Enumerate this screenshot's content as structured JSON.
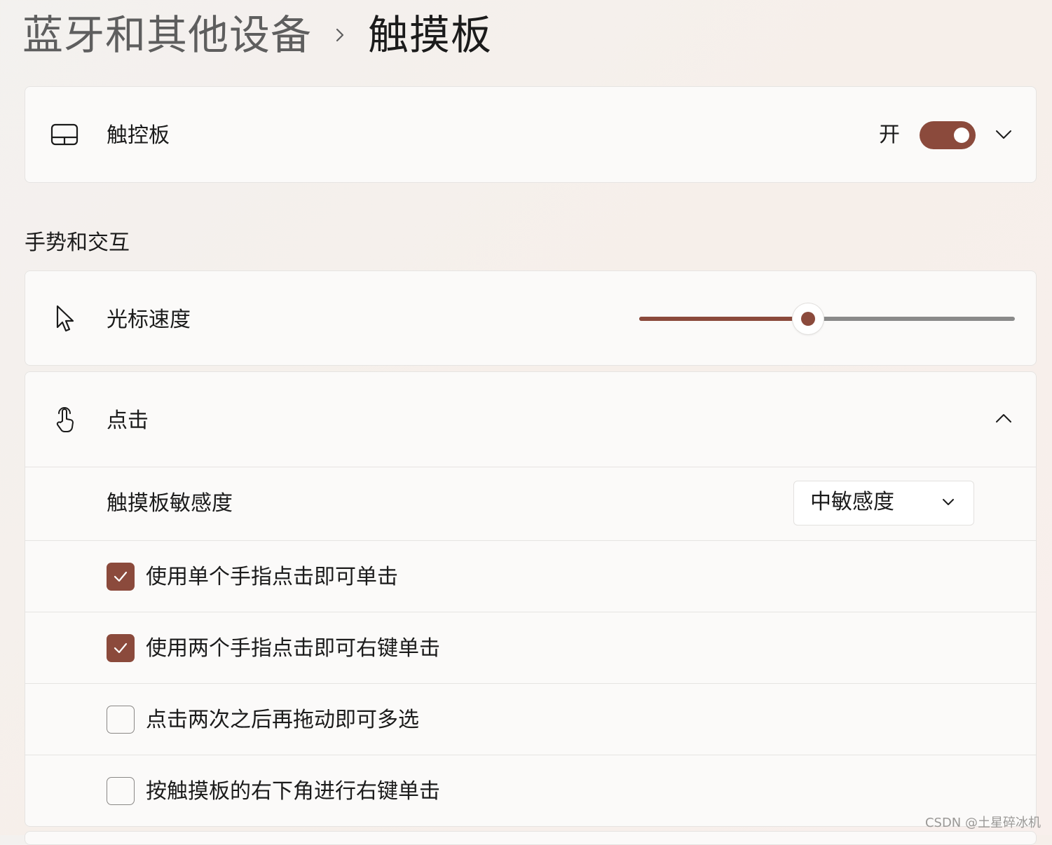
{
  "breadcrumb": {
    "parent": "蓝牙和其他设备",
    "current": "触摸板"
  },
  "touchpad": {
    "label": "触控板",
    "toggle_state_label": "开",
    "enabled": true
  },
  "section": {
    "title": "手势和交互"
  },
  "cursor_speed": {
    "label": "光标速度",
    "value_fraction": 0.45
  },
  "tap": {
    "label": "点击",
    "sensitivity_label": "触摸板敏感度",
    "sensitivity_value": "中敏感度",
    "options": [
      {
        "label": "使用单个手指点击即可单击",
        "checked": true
      },
      {
        "label": "使用两个手指点击即可右键单击",
        "checked": true
      },
      {
        "label": "点击两次之后再拖动即可多选",
        "checked": false
      },
      {
        "label": "按触摸板的右下角进行右键单击",
        "checked": false
      }
    ]
  },
  "watermark": "CSDN @土星碎冰机",
  "colors": {
    "accent": "#8b4a3c",
    "card": "#fbfaf9",
    "border": "#e6e4e2"
  }
}
